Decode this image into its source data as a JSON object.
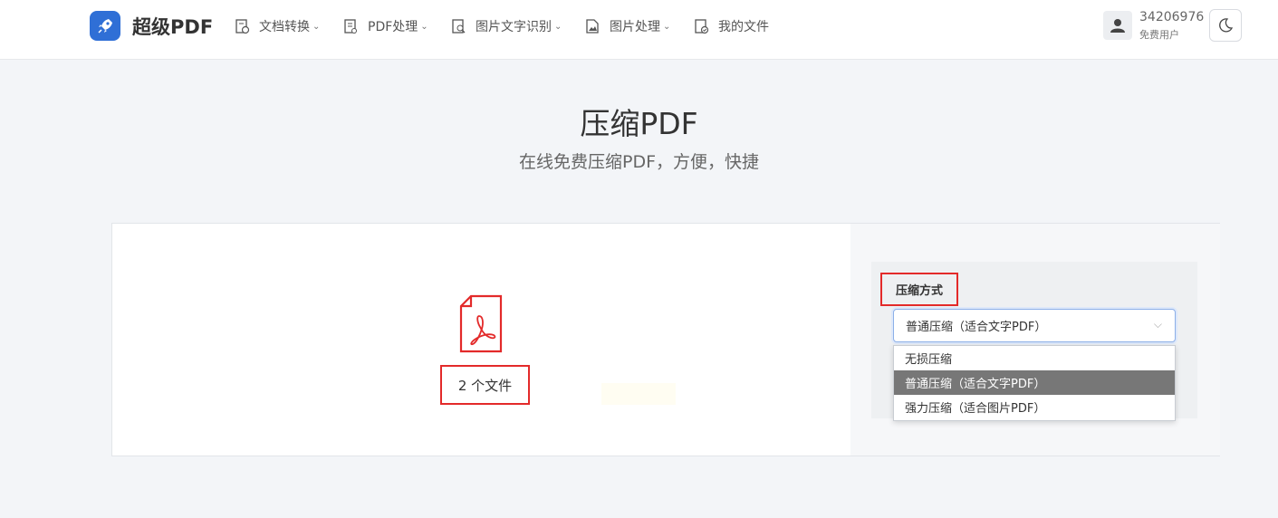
{
  "header": {
    "brand": "超级PDF",
    "nav": [
      {
        "label": "文档转换",
        "chevron": true
      },
      {
        "label": "PDF处理",
        "chevron": true
      },
      {
        "label": "图片文字识别",
        "chevron": true
      },
      {
        "label": "图片处理",
        "chevron": true
      },
      {
        "label": "我的文件",
        "chevron": false
      }
    ],
    "user": {
      "id": "34206976",
      "type": "免费用户"
    }
  },
  "hero": {
    "title": "压缩PDF",
    "subtitle": "在线免费压缩PDF，方便，快捷"
  },
  "upload": {
    "file_count": "2 个文件"
  },
  "settings": {
    "compress_label": "压缩方式",
    "selected_value": "普通压缩（适合文字PDF）",
    "options": [
      {
        "label": "无损压缩",
        "selected": false
      },
      {
        "label": "普通压缩（适合文字PDF）",
        "selected": true
      },
      {
        "label": "强力压缩（适合图片PDF）",
        "selected": false
      }
    ]
  },
  "colors": {
    "brand_blue": "#2f6fd6",
    "highlight_red": "#e32a2a",
    "selected_option_bg": "#777777"
  }
}
